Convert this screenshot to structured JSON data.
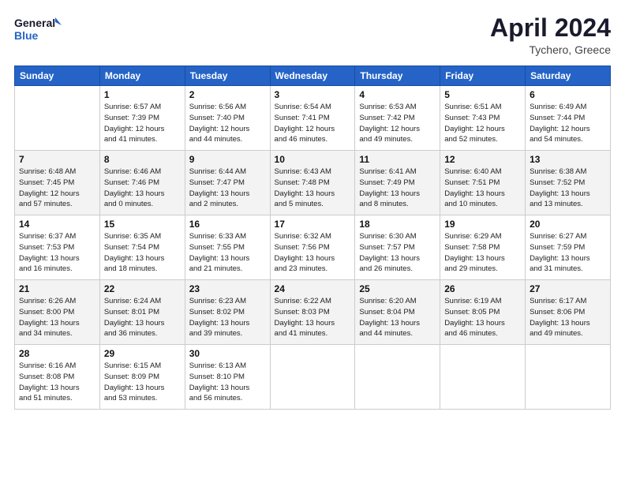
{
  "header": {
    "logo_line1": "General",
    "logo_line2": "Blue",
    "month_title": "April 2024",
    "location": "Tychero, Greece"
  },
  "weekdays": [
    "Sunday",
    "Monday",
    "Tuesday",
    "Wednesday",
    "Thursday",
    "Friday",
    "Saturday"
  ],
  "weeks": [
    [
      {
        "day": "",
        "info": ""
      },
      {
        "day": "1",
        "info": "Sunrise: 6:57 AM\nSunset: 7:39 PM\nDaylight: 12 hours\nand 41 minutes."
      },
      {
        "day": "2",
        "info": "Sunrise: 6:56 AM\nSunset: 7:40 PM\nDaylight: 12 hours\nand 44 minutes."
      },
      {
        "day": "3",
        "info": "Sunrise: 6:54 AM\nSunset: 7:41 PM\nDaylight: 12 hours\nand 46 minutes."
      },
      {
        "day": "4",
        "info": "Sunrise: 6:53 AM\nSunset: 7:42 PM\nDaylight: 12 hours\nand 49 minutes."
      },
      {
        "day": "5",
        "info": "Sunrise: 6:51 AM\nSunset: 7:43 PM\nDaylight: 12 hours\nand 52 minutes."
      },
      {
        "day": "6",
        "info": "Sunrise: 6:49 AM\nSunset: 7:44 PM\nDaylight: 12 hours\nand 54 minutes."
      }
    ],
    [
      {
        "day": "7",
        "info": "Sunrise: 6:48 AM\nSunset: 7:45 PM\nDaylight: 12 hours\nand 57 minutes."
      },
      {
        "day": "8",
        "info": "Sunrise: 6:46 AM\nSunset: 7:46 PM\nDaylight: 13 hours\nand 0 minutes."
      },
      {
        "day": "9",
        "info": "Sunrise: 6:44 AM\nSunset: 7:47 PM\nDaylight: 13 hours\nand 2 minutes."
      },
      {
        "day": "10",
        "info": "Sunrise: 6:43 AM\nSunset: 7:48 PM\nDaylight: 13 hours\nand 5 minutes."
      },
      {
        "day": "11",
        "info": "Sunrise: 6:41 AM\nSunset: 7:49 PM\nDaylight: 13 hours\nand 8 minutes."
      },
      {
        "day": "12",
        "info": "Sunrise: 6:40 AM\nSunset: 7:51 PM\nDaylight: 13 hours\nand 10 minutes."
      },
      {
        "day": "13",
        "info": "Sunrise: 6:38 AM\nSunset: 7:52 PM\nDaylight: 13 hours\nand 13 minutes."
      }
    ],
    [
      {
        "day": "14",
        "info": "Sunrise: 6:37 AM\nSunset: 7:53 PM\nDaylight: 13 hours\nand 16 minutes."
      },
      {
        "day": "15",
        "info": "Sunrise: 6:35 AM\nSunset: 7:54 PM\nDaylight: 13 hours\nand 18 minutes."
      },
      {
        "day": "16",
        "info": "Sunrise: 6:33 AM\nSunset: 7:55 PM\nDaylight: 13 hours\nand 21 minutes."
      },
      {
        "day": "17",
        "info": "Sunrise: 6:32 AM\nSunset: 7:56 PM\nDaylight: 13 hours\nand 23 minutes."
      },
      {
        "day": "18",
        "info": "Sunrise: 6:30 AM\nSunset: 7:57 PM\nDaylight: 13 hours\nand 26 minutes."
      },
      {
        "day": "19",
        "info": "Sunrise: 6:29 AM\nSunset: 7:58 PM\nDaylight: 13 hours\nand 29 minutes."
      },
      {
        "day": "20",
        "info": "Sunrise: 6:27 AM\nSunset: 7:59 PM\nDaylight: 13 hours\nand 31 minutes."
      }
    ],
    [
      {
        "day": "21",
        "info": "Sunrise: 6:26 AM\nSunset: 8:00 PM\nDaylight: 13 hours\nand 34 minutes."
      },
      {
        "day": "22",
        "info": "Sunrise: 6:24 AM\nSunset: 8:01 PM\nDaylight: 13 hours\nand 36 minutes."
      },
      {
        "day": "23",
        "info": "Sunrise: 6:23 AM\nSunset: 8:02 PM\nDaylight: 13 hours\nand 39 minutes."
      },
      {
        "day": "24",
        "info": "Sunrise: 6:22 AM\nSunset: 8:03 PM\nDaylight: 13 hours\nand 41 minutes."
      },
      {
        "day": "25",
        "info": "Sunrise: 6:20 AM\nSunset: 8:04 PM\nDaylight: 13 hours\nand 44 minutes."
      },
      {
        "day": "26",
        "info": "Sunrise: 6:19 AM\nSunset: 8:05 PM\nDaylight: 13 hours\nand 46 minutes."
      },
      {
        "day": "27",
        "info": "Sunrise: 6:17 AM\nSunset: 8:06 PM\nDaylight: 13 hours\nand 49 minutes."
      }
    ],
    [
      {
        "day": "28",
        "info": "Sunrise: 6:16 AM\nSunset: 8:08 PM\nDaylight: 13 hours\nand 51 minutes."
      },
      {
        "day": "29",
        "info": "Sunrise: 6:15 AM\nSunset: 8:09 PM\nDaylight: 13 hours\nand 53 minutes."
      },
      {
        "day": "30",
        "info": "Sunrise: 6:13 AM\nSunset: 8:10 PM\nDaylight: 13 hours\nand 56 minutes."
      },
      {
        "day": "",
        "info": ""
      },
      {
        "day": "",
        "info": ""
      },
      {
        "day": "",
        "info": ""
      },
      {
        "day": "",
        "info": ""
      }
    ]
  ]
}
